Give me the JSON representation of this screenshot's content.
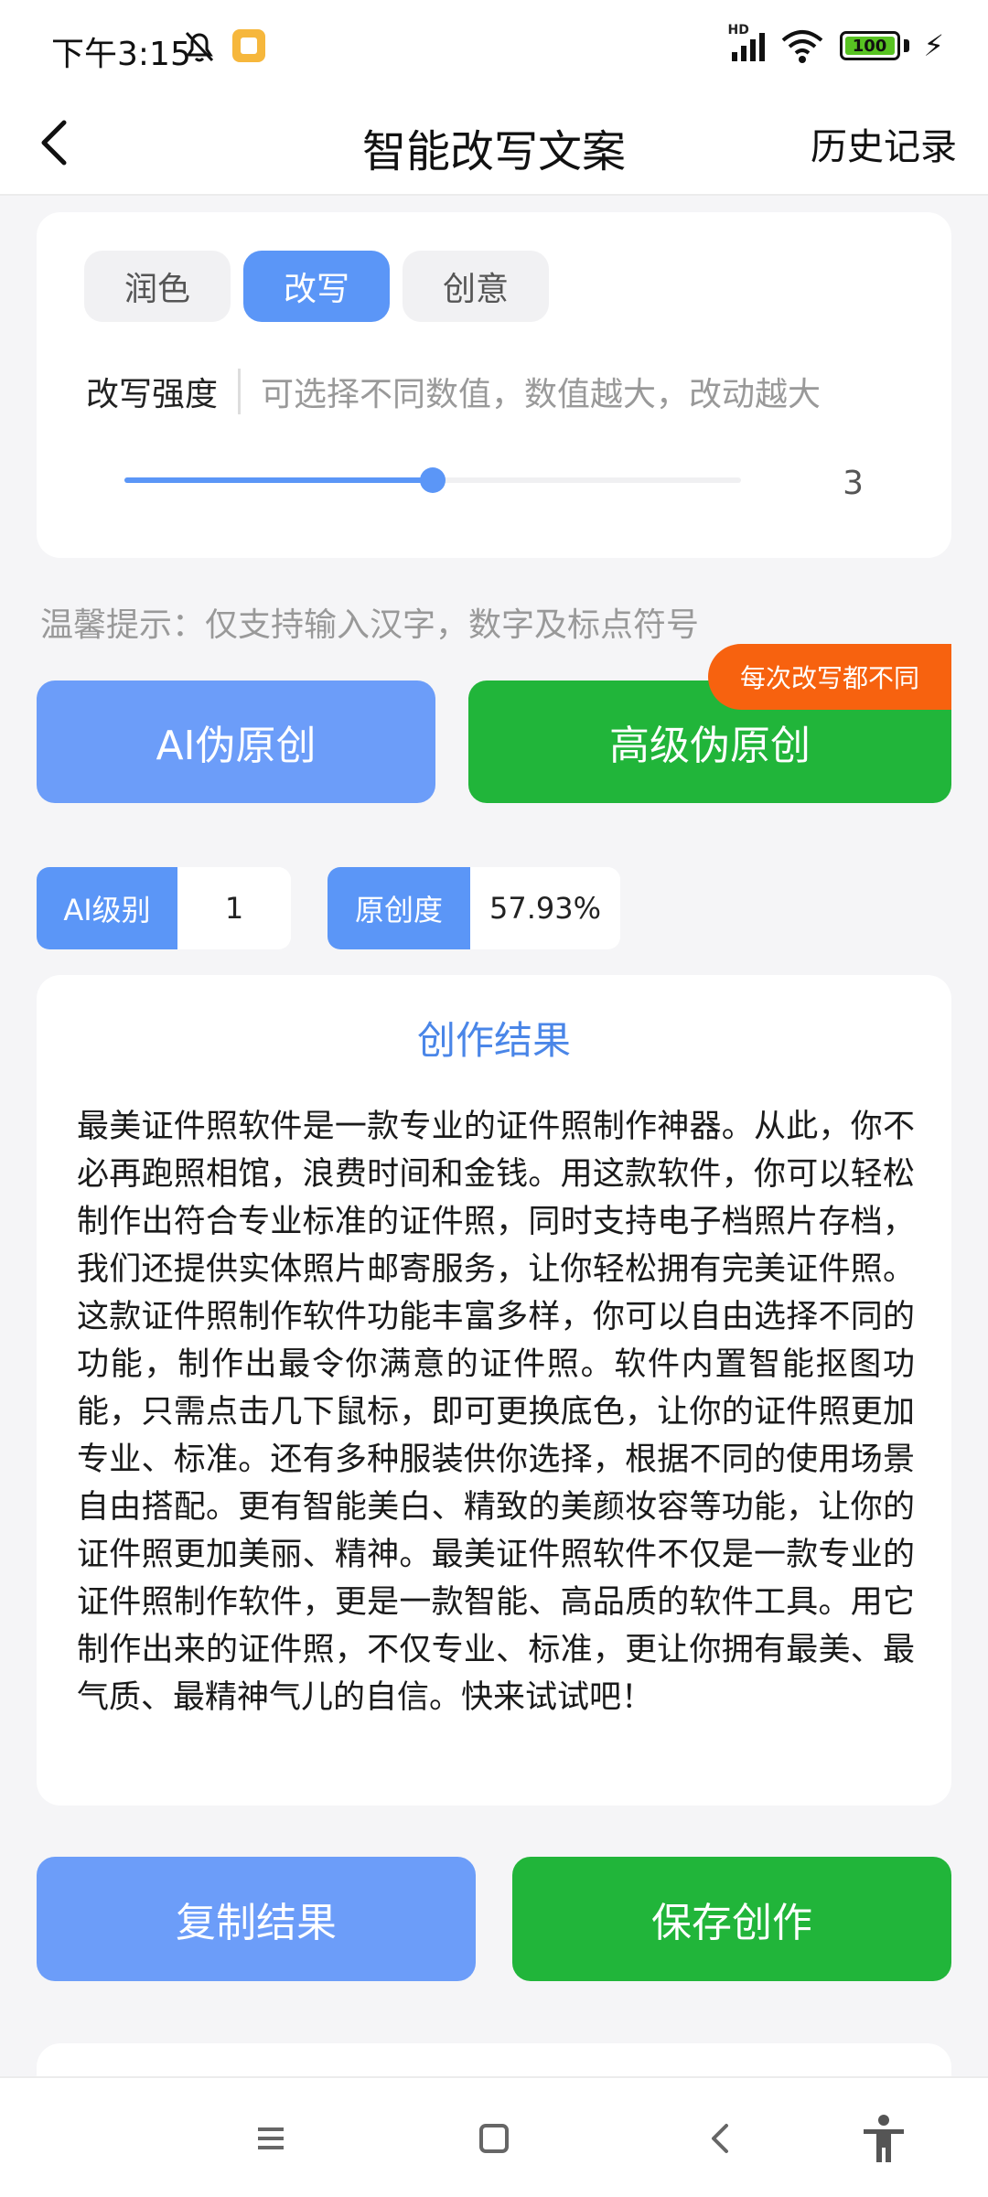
{
  "status_bar": {
    "time": "下午3:15",
    "battery": "100",
    "network": "HD"
  },
  "header": {
    "title": "智能改写文案",
    "history_label": "历史记录"
  },
  "settings": {
    "tabs": [
      {
        "label": "润色",
        "active": false
      },
      {
        "label": "改写",
        "active": true
      },
      {
        "label": "创意",
        "active": false
      }
    ],
    "intensity_label": "改写强度",
    "intensity_hint": "可选择不同数值，数值越大，改动越大",
    "slider_value": "3",
    "slider_fraction": 0.5
  },
  "tip": "温馨提示：仅支持输入汉字，数字及标点符号",
  "actions": {
    "ai_button": "AI伪原创",
    "advanced_button": "高级伪原创",
    "advanced_badge": "每次改写都不同"
  },
  "stats": {
    "ai_level_label": "AI级别",
    "ai_level_value": "1",
    "originality_label": "原创度",
    "originality_value": "57.93%"
  },
  "result": {
    "title": "创作结果",
    "text": "最美证件照软件是一款专业的证件照制作神器。从此，你不必再跑照相馆，浪费时间和金钱。用这款软件，你可以轻松制作出符合专业标准的证件照，同时支持电子档照片存档，我们还提供实体照片邮寄服务，让你轻松拥有完美证件照。这款证件照制作软件功能丰富多样，你可以自由选择不同的功能，制作出最令你满意的证件照。软件内置智能抠图功能，只需点击几下鼠标，即可更换底色，让你的证件照更加专业、标准。还有多种服装供你选择，根据不同的使用场景自由搭配。更有智能美白、精致的美颜妆容等功能，让你的证件照更加美丽、精神。最美证件照软件不仅是一款专业的证件照制作软件，更是一款智能、高品质的软件工具。用它制作出来的证件照，不仅专业、标准，更让你拥有最美、最气质、最精神气儿的自信。快来试试吧！"
  },
  "bottom_actions": {
    "copy_button": "复制结果",
    "save_button": "保存创作"
  },
  "colors": {
    "accent_blue": "#5b96f7",
    "button_blue": "#6c9df9",
    "button_green": "#21b53a",
    "badge_orange": "#f7620f"
  },
  "icons": {
    "back": "chevron-left-icon",
    "mute": "bell-off-icon",
    "app": "notes-app-icon",
    "signal": "signal-icon",
    "wifi": "wifi-icon",
    "battery": "battery-icon",
    "charging": "bolt-icon",
    "nav_menu": "menu-icon",
    "nav_home": "home-square-icon",
    "nav_back": "back-triangle-icon",
    "nav_accessibility": "accessibility-icon"
  }
}
